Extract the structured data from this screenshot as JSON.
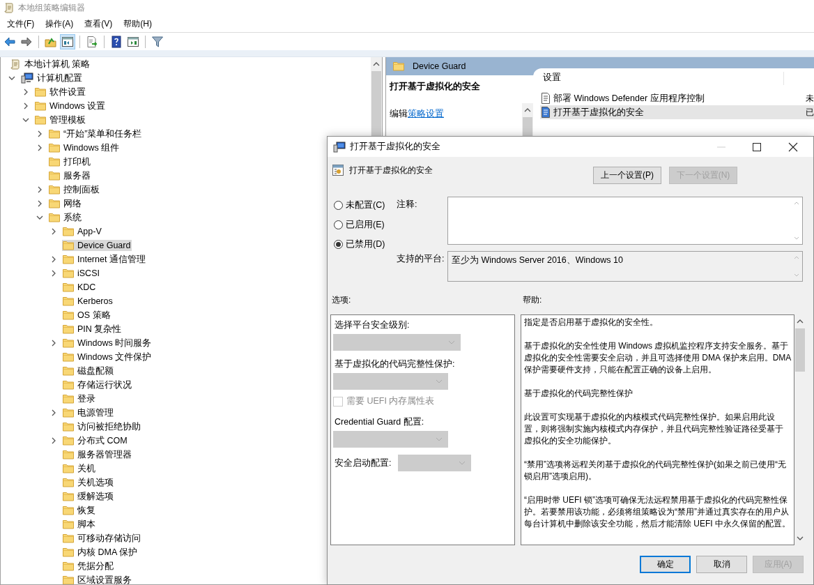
{
  "window": {
    "title": "本地组策略编辑器"
  },
  "menu": [
    "文件(F)",
    "操作(A)",
    "查看(V)",
    "帮助(H)"
  ],
  "toolbar": [
    {
      "kind": "back",
      "pressed": false
    },
    {
      "kind": "forward",
      "pressed": false
    },
    {
      "kind": "separator"
    },
    {
      "kind": "up_folder",
      "pressed": false
    },
    {
      "kind": "console_tree",
      "pressed": true
    },
    {
      "kind": "separator"
    },
    {
      "kind": "export",
      "pressed": false
    },
    {
      "kind": "separator"
    },
    {
      "kind": "help",
      "pressed": false
    },
    {
      "kind": "action_pane",
      "pressed": false
    },
    {
      "kind": "separator"
    },
    {
      "kind": "filter",
      "pressed": false
    }
  ],
  "tree": [
    {
      "label": "本地计算机 策略",
      "kind": "policy",
      "selected": false,
      "children": [
        {
          "label": "计算机配置",
          "kind": "computer",
          "expanded": true,
          "selected": false,
          "children": [
            {
              "label": "软件设置",
              "kind": "folder",
              "expanded": false,
              "selected": false
            },
            {
              "label": "Windows 设置",
              "kind": "folder",
              "expanded": false,
              "selected": false
            },
            {
              "label": "管理模板",
              "kind": "folder",
              "expanded": true,
              "selected": false,
              "children": [
                {
                  "label": "“开始”菜单和任务栏",
                  "kind": "folder",
                  "expanded": false,
                  "selected": false
                },
                {
                  "label": "Windows 组件",
                  "kind": "folder",
                  "expanded": false,
                  "selected": false
                },
                {
                  "label": "打印机",
                  "kind": "folder",
                  "selected": false
                },
                {
                  "label": "服务器",
                  "kind": "folder",
                  "selected": false
                },
                {
                  "label": "控制面板",
                  "kind": "folder",
                  "expanded": false,
                  "selected": false
                },
                {
                  "label": "网络",
                  "kind": "folder",
                  "expanded": false,
                  "selected": false
                },
                {
                  "label": "系统",
                  "kind": "folder",
                  "expanded": true,
                  "selected": false,
                  "children": [
                    {
                      "label": "App-V",
                      "kind": "folder",
                      "expanded": false,
                      "selected": false
                    },
                    {
                      "label": "Device Guard",
                      "kind": "folder",
                      "selected": true
                    },
                    {
                      "label": "Internet 通信管理",
                      "kind": "folder",
                      "expanded": false,
                      "selected": false
                    },
                    {
                      "label": "iSCSI",
                      "kind": "folder",
                      "expanded": false,
                      "selected": false
                    },
                    {
                      "label": "KDC",
                      "kind": "folder",
                      "selected": false
                    },
                    {
                      "label": "Kerberos",
                      "kind": "folder",
                      "selected": false
                    },
                    {
                      "label": "OS 策略",
                      "kind": "folder",
                      "selected": false
                    },
                    {
                      "label": "PIN 复杂性",
                      "kind": "folder",
                      "selected": false
                    },
                    {
                      "label": "Windows 时间服务",
                      "kind": "folder",
                      "expanded": false,
                      "selected": false
                    },
                    {
                      "label": "Windows 文件保护",
                      "kind": "folder",
                      "selected": false
                    },
                    {
                      "label": "磁盘配额",
                      "kind": "folder",
                      "selected": false
                    },
                    {
                      "label": "存储运行状况",
                      "kind": "folder",
                      "selected": false
                    },
                    {
                      "label": "登录",
                      "kind": "folder",
                      "selected": false
                    },
                    {
                      "label": "电源管理",
                      "kind": "folder",
                      "expanded": false,
                      "selected": false
                    },
                    {
                      "label": "访问被拒绝协助",
                      "kind": "folder",
                      "selected": false
                    },
                    {
                      "label": "分布式 COM",
                      "kind": "folder",
                      "expanded": false,
                      "selected": false
                    },
                    {
                      "label": "服务器管理器",
                      "kind": "folder",
                      "selected": false
                    },
                    {
                      "label": "关机",
                      "kind": "folder",
                      "selected": false
                    },
                    {
                      "label": "关机选项",
                      "kind": "folder",
                      "selected": false
                    },
                    {
                      "label": "缓解选项",
                      "kind": "folder",
                      "selected": false
                    },
                    {
                      "label": "恢复",
                      "kind": "folder",
                      "selected": false
                    },
                    {
                      "label": "脚本",
                      "kind": "folder",
                      "selected": false
                    },
                    {
                      "label": "可移动存储访问",
                      "kind": "folder",
                      "selected": false
                    },
                    {
                      "label": "内核 DMA 保护",
                      "kind": "folder",
                      "selected": false
                    },
                    {
                      "label": "凭据分配",
                      "kind": "folder",
                      "selected": false
                    },
                    {
                      "label": "区域设置服务",
                      "kind": "folder",
                      "selected": false
                    }
                  ]
                }
              ]
            }
          ]
        }
      ]
    }
  ],
  "pane": {
    "header": "Device Guard",
    "description_title": "打开基于虚拟化的安全",
    "edit_prefix": "编辑",
    "edit_link": "策略设置",
    "column_1": "设置",
    "rows": [
      {
        "name": "部署 Windows Defender 应用程序控制",
        "column_2": "未",
        "selected": false
      },
      {
        "name": "打开基于虚拟化的安全",
        "column_2": "已",
        "selected": true
      }
    ]
  },
  "dialog": {
    "title": "打开基于虚拟化的安全",
    "minimize_disabled": true,
    "setting_name": "打开基于虚拟化的安全",
    "nav_buttons": [
      {
        "label": "上一个设置(P)",
        "disabled": false
      },
      {
        "label": "下一个设置(N)",
        "disabled": true
      }
    ],
    "radios": [
      {
        "label": "未配置(C)",
        "selected": false
      },
      {
        "label": "已启用(E)",
        "selected": false
      },
      {
        "label": "已禁用(D)",
        "selected": true
      }
    ],
    "comment_label": "注释:",
    "platform_label": "支持的平台:",
    "platform": "至少为 Windows Server 2016、Windows 10",
    "options_label": "选项:",
    "help_label": "帮助:",
    "options": [
      {
        "kind": "label",
        "text": "选择平台安全级别:"
      },
      {
        "kind": "dropdown",
        "disabled": true
      },
      {
        "kind": "label",
        "text": "基于虚拟化的代码完整性保护:"
      },
      {
        "kind": "dropdown",
        "disabled": true
      },
      {
        "kind": "checkbox",
        "label": "需要 UEFI 内存属性表",
        "checked": false,
        "disabled": true
      },
      {
        "kind": "label",
        "text": "Credential Guard 配置:"
      },
      {
        "kind": "dropdown",
        "disabled": true
      },
      {
        "kind": "labeled_dropdown",
        "label": "安全启动配置:",
        "disabled": true
      }
    ],
    "help": [
      "指定是否启用基于虚拟化的安全性。",
      "基于虚拟化的安全性使用 Windows 虚拟机监控程序支持安全服务。基于虚拟化的安全性需要安全启动，并且可选择使用 DMA 保护来启用。DMA 保护需要硬件支持，只能在配置正确的设备上启用。",
      "基于虚拟化的代码完整性保护",
      "此设置可实现基于虚拟化的内核模式代码完整性保护。如果启用此设置，则将强制实施内核模式内存保护，并且代码完整性验证路径受基于虚拟化的安全功能保护。",
      "“禁用”选项将远程关闭基于虚拟化的代码完整性保护(如果之前已使用“无锁启用”选项启用)。",
      "“启用时带 UEFI 锁”选项可确保无法远程禁用基于虚拟化的代码完整性保护。若要禁用该功能，必须将组策略设为“禁用”并通过真实存在的用户从每台计算机中删除该安全功能，然后才能清除 UEFI 中永久保留的配置。"
    ],
    "footer_buttons": [
      {
        "label": "确定",
        "disabled": false,
        "default": true
      },
      {
        "label": "取消",
        "disabled": false,
        "default": false
      },
      {
        "label": "应用(A)",
        "disabled": true,
        "default": false
      }
    ]
  }
}
